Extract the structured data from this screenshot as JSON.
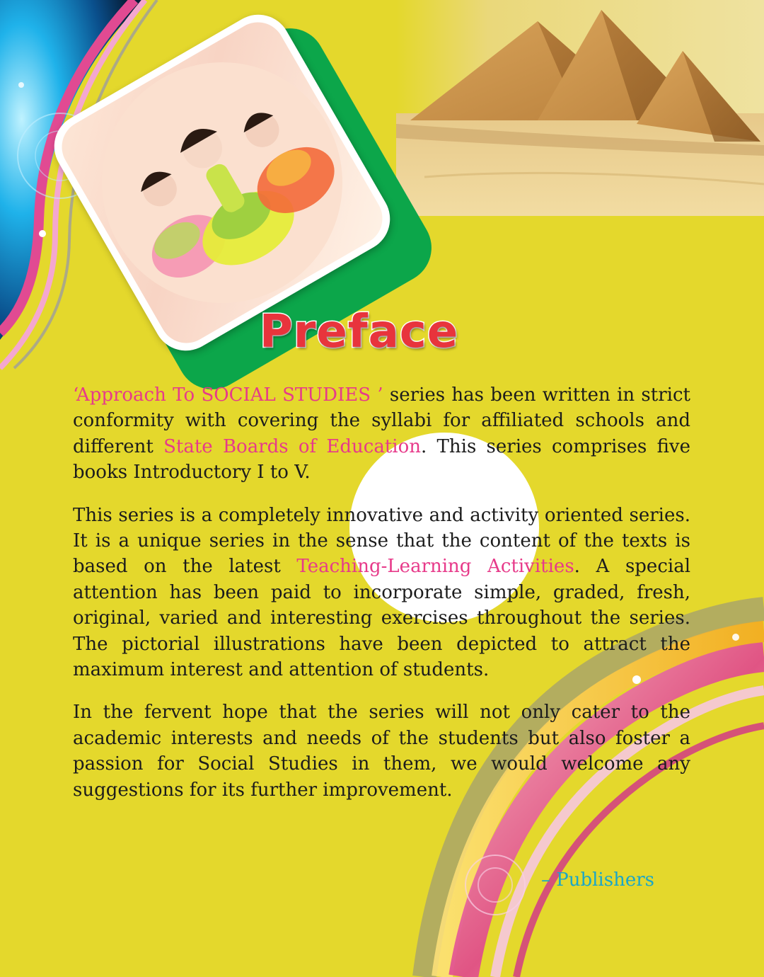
{
  "title": "Preface",
  "paragraphs": [
    {
      "series_name": "‘Approach To SOCIAL STUDIES ’",
      "text_a": " series has been written in strict conformity with covering the syllabi  for affiliated schools and different ",
      "boards": "State Boards of Education",
      "text_b": ". This series comprises five books Introductory I to V."
    },
    {
      "text_a": "This series is a completely innovative and activity oriented series. It is a unique series in the sense that the content of the texts is based on the latest ",
      "activities": "Teaching-Learning Activities",
      "text_b": ". A special attention has been paid to incorporate simple, graded, fresh, original, varied and interesting exercises throughout the series. The pictorial illustrations have been depicted to attract the maximum interest and attention of students."
    },
    {
      "text": "In the fervent hope that the series will not only cater to the academic interests and needs of the students but also foster a passion for Social Studies in them, we would welcome any suggestions for its further improvement."
    }
  ],
  "signature": "– Publishers",
  "colors": {
    "background": "#e4d82c",
    "title": "#e8343c",
    "highlight": "#e73a8a",
    "signature": "#1aa6c8",
    "green_panel": "#0ca64a"
  },
  "images": {
    "top_right": "pyramids-photo",
    "photo_card": "children-dancers-photo",
    "left_swirl": "blue-pink-swirl",
    "bottom_right_swirl": "rainbow-swirl"
  }
}
